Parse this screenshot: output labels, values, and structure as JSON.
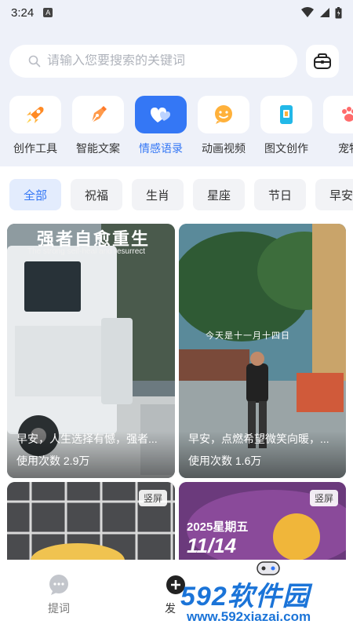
{
  "status_bar": {
    "time": "3:24",
    "a_badge": "A"
  },
  "search": {
    "placeholder": "请输入您要搜索的关键词"
  },
  "categories": [
    {
      "label": "创作工具",
      "icon": "rocket-icon",
      "active": false
    },
    {
      "label": "智能文案",
      "icon": "pen-nib-icon",
      "active": false
    },
    {
      "label": "情感语录",
      "icon": "hearts-icon",
      "active": true
    },
    {
      "label": "动画视频",
      "icon": "smiley-chat-icon",
      "active": false
    },
    {
      "label": "图文创作",
      "icon": "document-icon",
      "active": false
    },
    {
      "label": "宠物",
      "icon": "paw-icon",
      "active": false
    }
  ],
  "chips": [
    "全部",
    "祝福",
    "生肖",
    "星座",
    "节日",
    "早安"
  ],
  "cards": [
    {
      "overlay_title": "强者自愈重生",
      "overlay_subtitle": "The strong self-heal and resurrect",
      "caption": "早安，人生选择有憾，强者...",
      "count": "使用次数 2.9万"
    },
    {
      "overlay_text": "今天是十一月十四日",
      "caption": "早安，点燃希望微笑向暖，...",
      "count": "使用次数 1.6万"
    },
    {
      "tag": "竖屏"
    },
    {
      "tag": "竖屏",
      "date_line1": "2025星期五",
      "date_line2": "11/14"
    }
  ],
  "bottom_nav": [
    {
      "label": "提词",
      "icon": "chat-bubble-icon"
    },
    {
      "label": "发",
      "icon": "publish-icon"
    }
  ],
  "watermark": {
    "big": "592软件园",
    "url": "www.592xiazai.com"
  },
  "colors": {
    "accent": "#3477f5",
    "background": "#eef1f9",
    "watermark": "#1b74d8"
  }
}
